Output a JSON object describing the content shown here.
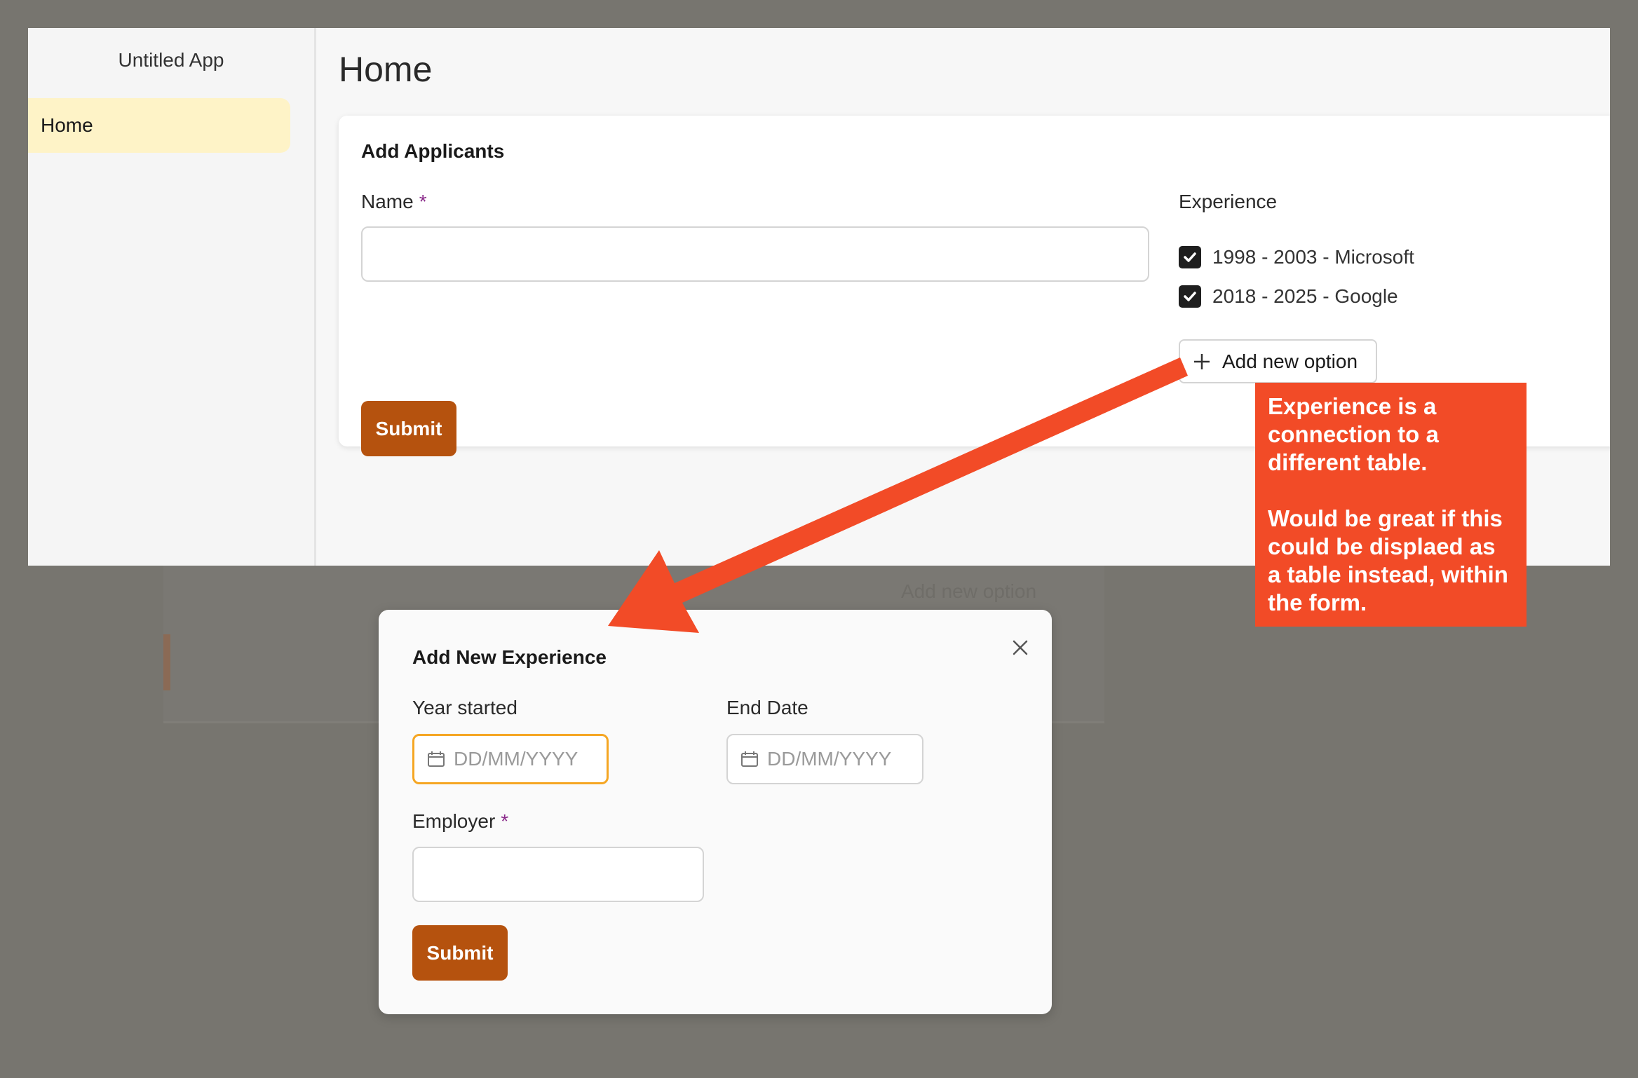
{
  "app": {
    "title": "Untitled App",
    "nav": [
      {
        "label": "Home",
        "active": true
      }
    ]
  },
  "page": {
    "title": "Home",
    "form": {
      "title": "Add Applicants",
      "name_label": "Name",
      "required_mark": "*",
      "name_value": "",
      "experience_label": "Experience",
      "experience_options": [
        {
          "label": "1998 - 2003 - Microsoft",
          "checked": true
        },
        {
          "label": "2018 - 2025 - Google",
          "checked": true
        }
      ],
      "add_option_label": "Add new option",
      "submit_label": "Submit"
    }
  },
  "background_ghost": {
    "add_option_label": "Add new option"
  },
  "modal": {
    "title": "Add New Experience",
    "year_started_label": "Year started",
    "year_started_placeholder": "DD/MM/YYYY",
    "end_date_label": "End Date",
    "end_date_placeholder": "DD/MM/YYYY",
    "employer_label": "Employer",
    "required_mark": "*",
    "employer_value": "",
    "submit_label": "Submit"
  },
  "annotation": {
    "line1": "Experience is a connection to a different table.",
    "line2": "Would be great if this could be displaed as a table instead, within the form."
  },
  "colors": {
    "backdrop": "#77756f",
    "accent_button": "#b5520e",
    "nav_active": "#fef3c7",
    "focus_border": "#f5a623",
    "annotation": "#f24b27",
    "required": "#8a2a8a"
  },
  "icons": [
    "plus-icon",
    "checkmark-icon",
    "calendar-icon",
    "close-icon",
    "arrow-annotation"
  ]
}
